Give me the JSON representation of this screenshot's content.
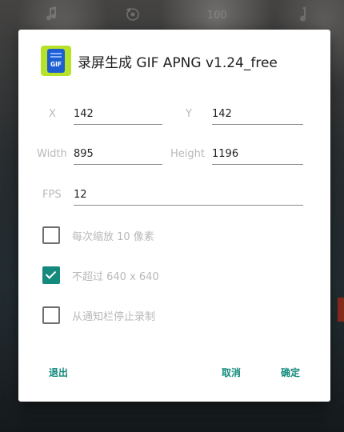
{
  "status_bar": {
    "battery": "100"
  },
  "dialog": {
    "title": "录屏生成 GIF APNG v1.24_free",
    "app_icon_text": "GIF",
    "fields": {
      "x": {
        "label": "X",
        "value": "142"
      },
      "y": {
        "label": "Y",
        "value": "142"
      },
      "width": {
        "label": "Width",
        "value": "895"
      },
      "height": {
        "label": "Height",
        "value": "1196"
      },
      "fps": {
        "label": "FPS",
        "value": "12"
      }
    },
    "options": [
      {
        "label": "每次缩放 10 像素",
        "checked": false
      },
      {
        "label": "不超过 640 x 640",
        "checked": true
      },
      {
        "label": "从通知栏停止录制",
        "checked": false
      }
    ],
    "buttons": {
      "exit": "退出",
      "cancel": "取消",
      "confirm": "确定"
    }
  },
  "colors": {
    "accent": "#138a7c",
    "icon_bg": "#b7e22a",
    "icon_phone": "#1d5fd1"
  }
}
